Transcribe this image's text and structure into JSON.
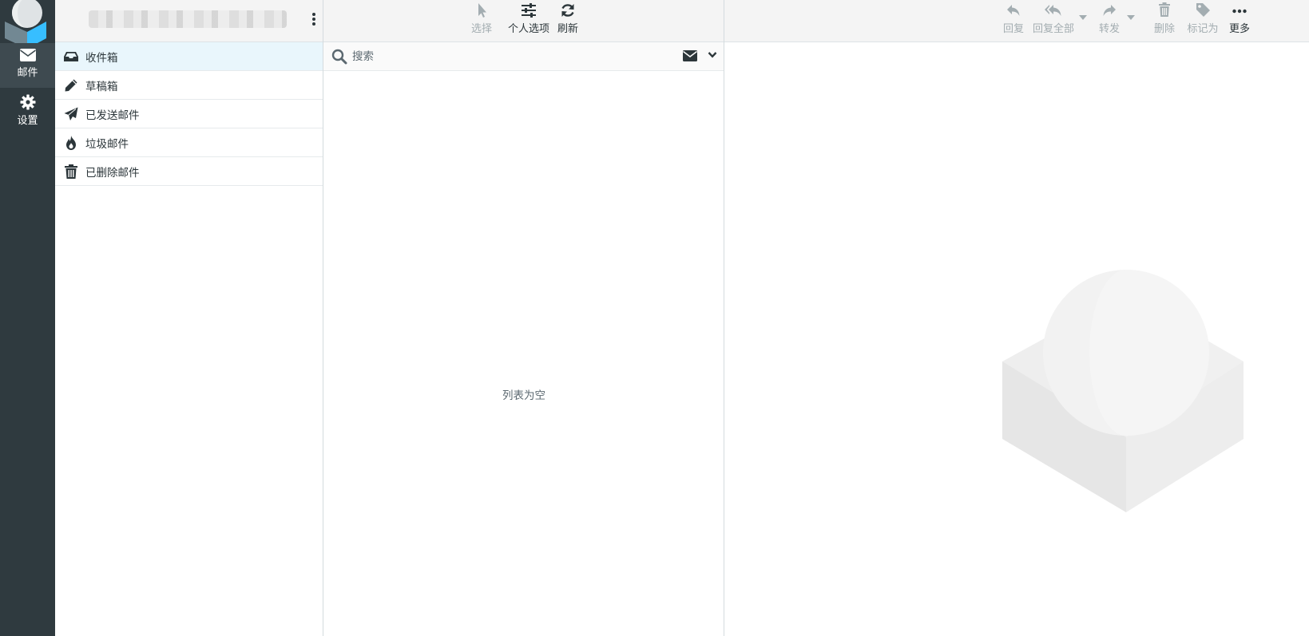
{
  "rail": {
    "items": [
      {
        "label": "邮件",
        "icon": "envelope-icon",
        "active": true
      },
      {
        "label": "设置",
        "icon": "gear-icon",
        "active": false
      }
    ]
  },
  "folders": {
    "items": [
      {
        "name": "收件箱",
        "icon": "inbox-icon",
        "selected": true
      },
      {
        "name": "草稿箱",
        "icon": "pencil-icon"
      },
      {
        "name": "已发送邮件",
        "icon": "paper-plane-icon"
      },
      {
        "name": "垃圾邮件",
        "icon": "fire-icon"
      },
      {
        "name": "已删除邮件",
        "icon": "trash-icon"
      }
    ]
  },
  "list_toolbar": {
    "select": "选择",
    "options": "个人选项",
    "refresh": "刷新"
  },
  "search": {
    "placeholder": "搜索"
  },
  "list": {
    "empty_text": "列表为空"
  },
  "preview_toolbar": {
    "reply": "回复",
    "reply_all": "回复全部",
    "forward": "转发",
    "delete": "删除",
    "mark": "标记为",
    "more": "更多"
  },
  "colors": {
    "rail_bg": "#2f3a3f",
    "accent": "#37beff",
    "selected_folder_bg": "#e9f6fc"
  }
}
